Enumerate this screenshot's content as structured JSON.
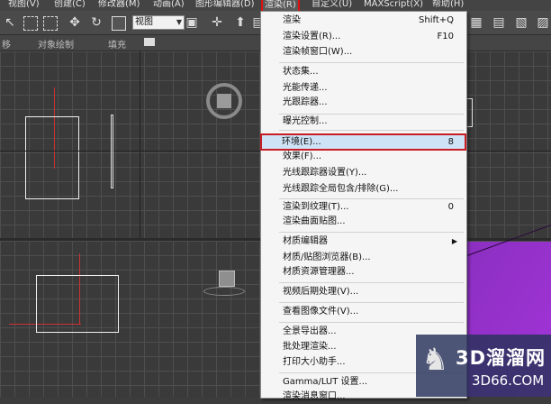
{
  "menubar": {
    "items": [
      {
        "label": "视图(V)"
      },
      {
        "label": "创建(C)"
      },
      {
        "label": "修改器(M)"
      },
      {
        "label": "动画(A)"
      },
      {
        "label": "图形编辑器(D)"
      },
      {
        "label": "渲染(R)",
        "active": true
      },
      {
        "label": "自定义(U)"
      },
      {
        "label": "MAXScript(X)"
      },
      {
        "label": "帮助(H)"
      }
    ]
  },
  "toolbar": {
    "view_select": "视图"
  },
  "ribbon": {
    "labels": [
      "移",
      "对象绘制",
      "填充"
    ]
  },
  "render_menu": {
    "items": [
      {
        "label": "渲染",
        "shortcut": "Shift+Q"
      },
      {
        "label": "渲染设置(R)...",
        "shortcut": "F10"
      },
      {
        "label": "渲染帧窗口(W)..."
      },
      {
        "label": "状态集..."
      },
      {
        "label": "光能传递..."
      },
      {
        "label": "光跟踪器..."
      },
      {
        "label": "曝光控制..."
      },
      {
        "label": "环境(E)...",
        "shortcut": "8",
        "highlighted": true
      },
      {
        "label": "效果(F)..."
      },
      {
        "label": "光线跟踪器设置(Y)..."
      },
      {
        "label": "光线跟踪全局包含/排除(G)..."
      },
      {
        "label": "渲染到纹理(T)...",
        "shortcut": "0"
      },
      {
        "label": "渲染曲面贴图..."
      },
      {
        "label": "材质编辑器",
        "submenu": true
      },
      {
        "label": "材质/贴图浏览器(B)..."
      },
      {
        "label": "材质资源管理器..."
      },
      {
        "label": "视频后期处理(V)..."
      },
      {
        "label": "查看图像文件(V)..."
      },
      {
        "label": "全景导出器..."
      },
      {
        "label": "批处理渲染..."
      },
      {
        "label": "打印大小助手..."
      },
      {
        "label": "Gamma/LUT 设置..."
      },
      {
        "label": "渲染消息窗口..."
      }
    ]
  },
  "watermark": {
    "brand": "3D溜溜网",
    "domain": "3D66.COM"
  },
  "colors": {
    "highlight_border": "#c81d25",
    "highlight_fill": "#cfe3f7",
    "object_purple": "#9a33d0"
  }
}
